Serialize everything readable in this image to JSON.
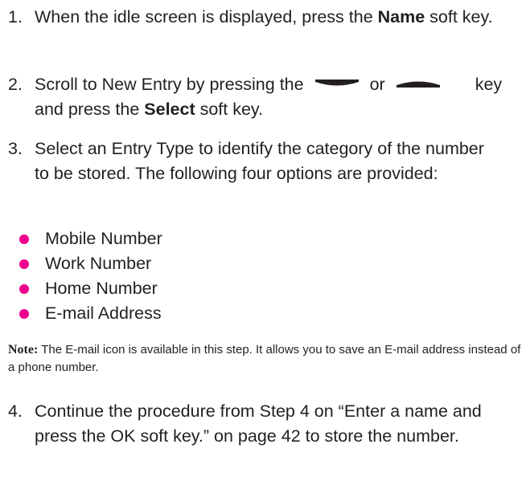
{
  "steps": [
    {
      "number": "1.",
      "text_before": "When the idle screen is displayed, press the ",
      "bold": "Name",
      "text_after": " soft key."
    },
    {
      "number": "2.",
      "text_before": "Scroll to New Entry by pressing the",
      "icon_down": "scroll-down-key-icon",
      "or_word": "or",
      "icon_up": "scroll-up-key-icon",
      "text_key": "key and press the ",
      "bold": "Select",
      "text_after": " soft key."
    },
    {
      "number": "3.",
      "text": "Select an Entry Type to identify the category of the number to be stored. The following four options are provided:"
    },
    {
      "number": "4.",
      "text": "Continue the procedure from Step 4 on “Enter a name and press the OK soft key.” on page 42 to store the number."
    }
  ],
  "options": [
    "Mobile Number",
    "Work Number",
    "Home Number",
    "E-mail Address"
  ],
  "note": {
    "label": "Note:",
    "text": " The E-mail icon is available in this step. It allows you to save an E-mail address instead of a phone number."
  },
  "colors": {
    "bullet": "#ec008c",
    "text": "#231f20"
  }
}
